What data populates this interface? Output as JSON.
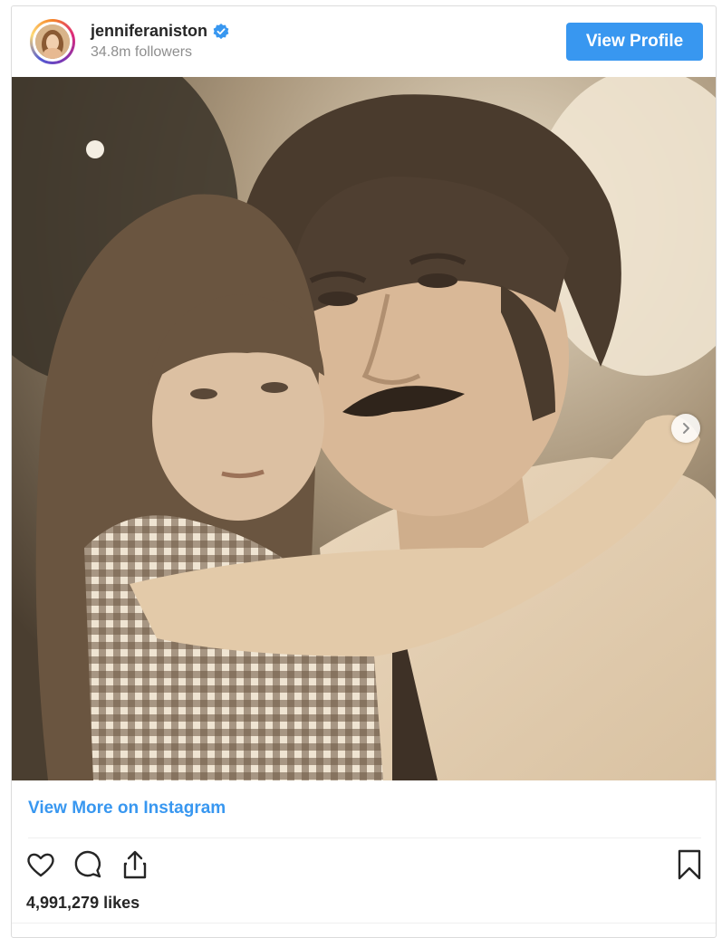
{
  "post": {
    "username": "jenniferaniston",
    "followers": "34.8m followers",
    "view_profile_label": "View Profile",
    "view_more_label": "View More on Instagram",
    "likes": "4,991,279 likes",
    "verified": true,
    "carousel": {
      "current_slide": 1,
      "total_slides": 2
    }
  },
  "icons": {
    "verified": "verified-badge-icon",
    "like": "heart-icon",
    "comment": "comment-bubble-icon",
    "share": "share-icon",
    "save": "bookmark-icon",
    "next": "chevron-right-icon"
  },
  "colors": {
    "accent": "#3897f0",
    "text": "#262626",
    "muted": "#8e8e8e",
    "photo_tone": "#c7b092"
  }
}
